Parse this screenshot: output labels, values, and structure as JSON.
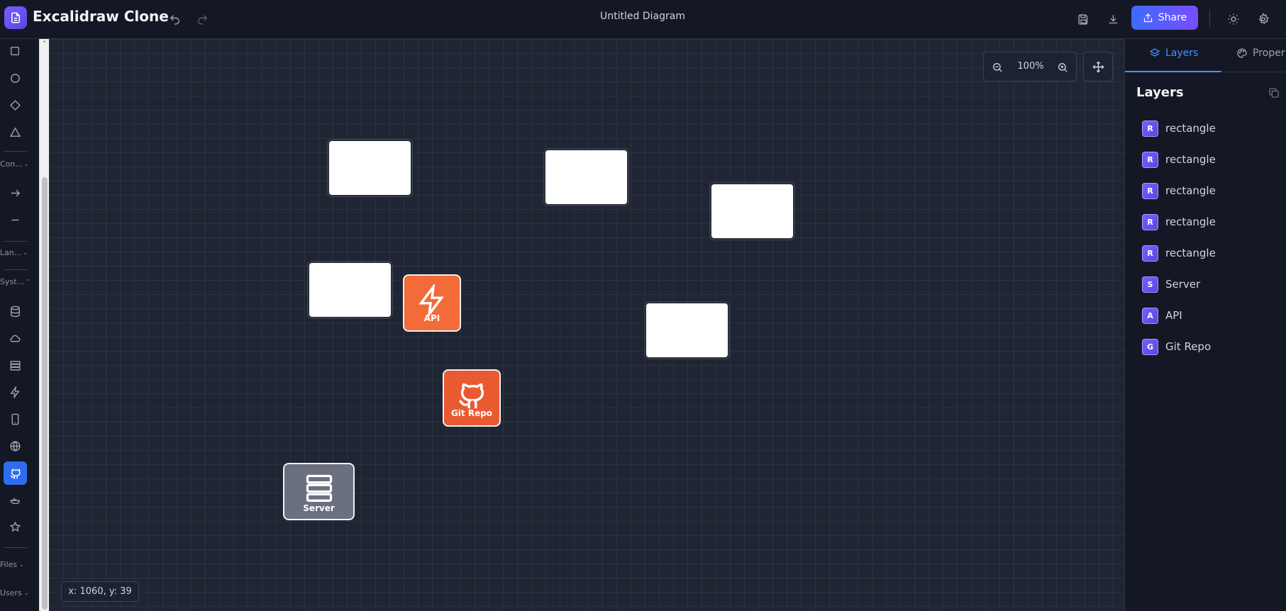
{
  "app": {
    "title": "Excalidraw Clone",
    "document_title": "Untitled Diagram"
  },
  "header": {
    "share_label": "Share"
  },
  "toolbar": {
    "sections": {
      "connectors": "Con...",
      "languages": "Lan...",
      "system": "Syst...",
      "files": "Files",
      "users": "Users"
    }
  },
  "canvas": {
    "zoom": "100%",
    "coords": "x: 1060, y: 39",
    "nodes": {
      "api": "API",
      "git": "Git Repo",
      "server": "Server"
    }
  },
  "right_panel": {
    "tabs": {
      "layers": "Layers",
      "properties": "Proper"
    },
    "title": "Layers",
    "layers": [
      {
        "badge": "R",
        "name": "rectangle"
      },
      {
        "badge": "R",
        "name": "rectangle"
      },
      {
        "badge": "R",
        "name": "rectangle"
      },
      {
        "badge": "R",
        "name": "rectangle"
      },
      {
        "badge": "R",
        "name": "rectangle"
      },
      {
        "badge": "S",
        "name": "Server"
      },
      {
        "badge": "A",
        "name": "API"
      },
      {
        "badge": "G",
        "name": "Git Repo"
      }
    ]
  },
  "colors": {
    "accent": "#2f6cf0",
    "api_node": "#f26b38",
    "git_node": "#ea5a30",
    "server_node": "#6b7080"
  }
}
